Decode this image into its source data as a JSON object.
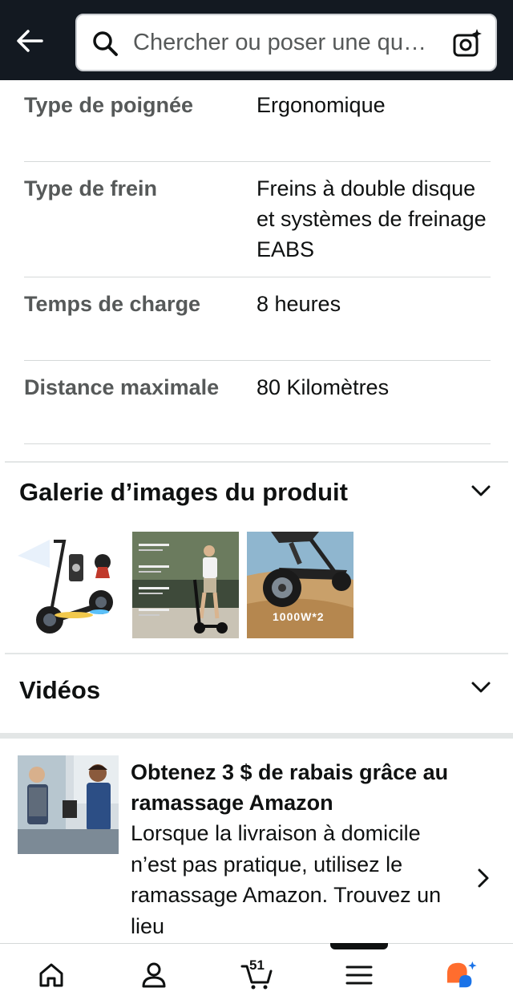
{
  "header": {
    "search_placeholder": "Chercher ou poser une qu…"
  },
  "specs": [
    {
      "key": "Type de poignée",
      "value": "Ergonomique"
    },
    {
      "key": "Type de frein",
      "value": "Freins à double disque et systèmes de freinage EABS"
    },
    {
      "key": "Temps de charge",
      "value": "8 heures"
    },
    {
      "key": "Distance maximale",
      "value": "80 Kilomètres"
    }
  ],
  "gallery": {
    "title": "Galerie d’images du produit",
    "thumb3_caption": "1000W*2"
  },
  "videos": {
    "title": "Vidéos"
  },
  "promo": {
    "title": "Obtenez 3 $ de rabais grâce au ramassage Amazon",
    "body": "Lorsque la livraison à domicile n’est pas pratique, utilisez le ramassage Amazon. Trouvez un lieu"
  },
  "bottom_nav": {
    "cart_count": "51",
    "items": [
      "home-icon",
      "account-icon",
      "cart-icon",
      "menu-icon",
      "rufus-icon"
    ]
  },
  "colors": {
    "header_bg": "#131921",
    "rufus_orange": "#ff6d2e",
    "rufus_blue": "#1a73e8"
  }
}
